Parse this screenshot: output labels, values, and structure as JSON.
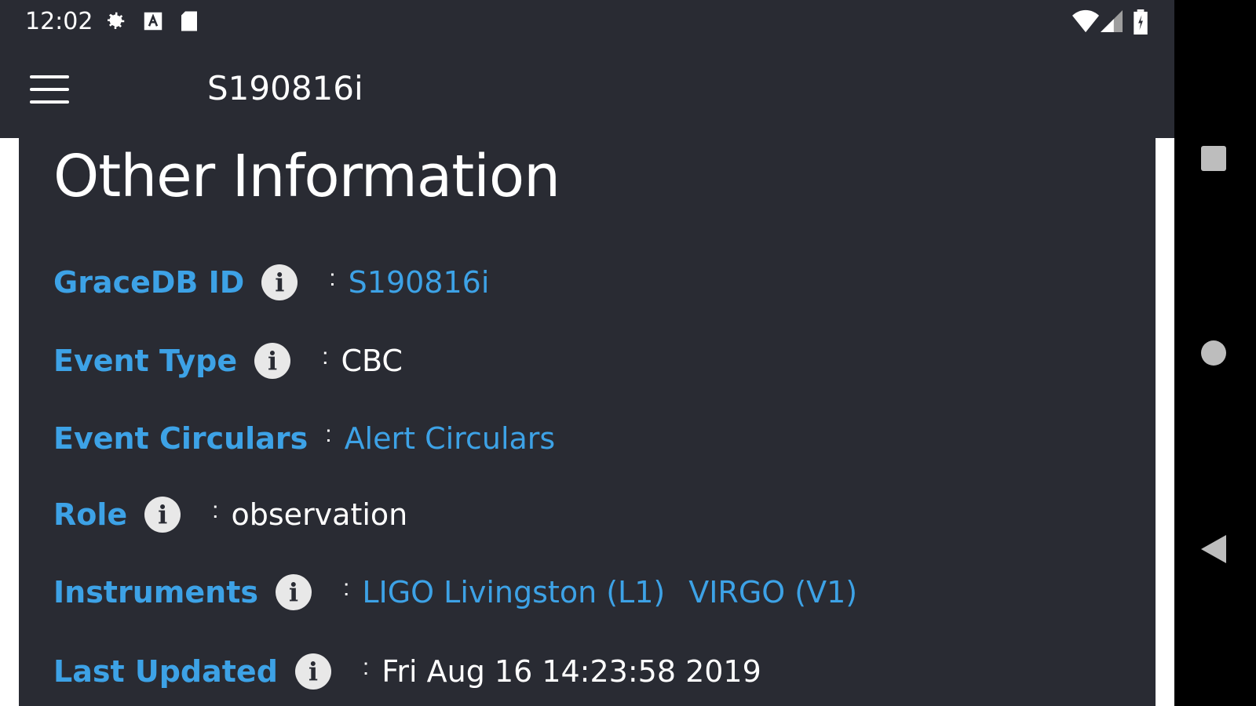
{
  "status_bar": {
    "time": "12:02",
    "icons_left": [
      "gear-icon",
      "a-icon",
      "sd-card-icon"
    ],
    "icons_right": [
      "wifi-icon",
      "signal-icon",
      "battery-icon"
    ]
  },
  "app_bar": {
    "title": "S190816i"
  },
  "section": {
    "title": "Other Information",
    "rows": [
      {
        "label": "GraceDB ID",
        "value": "S190816i"
      },
      {
        "label": "Event Type",
        "value": "CBC"
      },
      {
        "label": "Event Circulars",
        "value": "Alert Circulars"
      },
      {
        "label": "Role",
        "value": "observation"
      },
      {
        "label": "Instruments",
        "values": [
          "LIGO Livingston (L1)",
          "VIRGO (V1)"
        ]
      },
      {
        "label": "Last Updated",
        "value": "Fri Aug 16 14:23:58 2019"
      }
    ],
    "separator": ":",
    "info_glyph": "i"
  },
  "colors": {
    "background": "#292b33",
    "accent": "#3da2e6",
    "text": "#ffffff"
  }
}
